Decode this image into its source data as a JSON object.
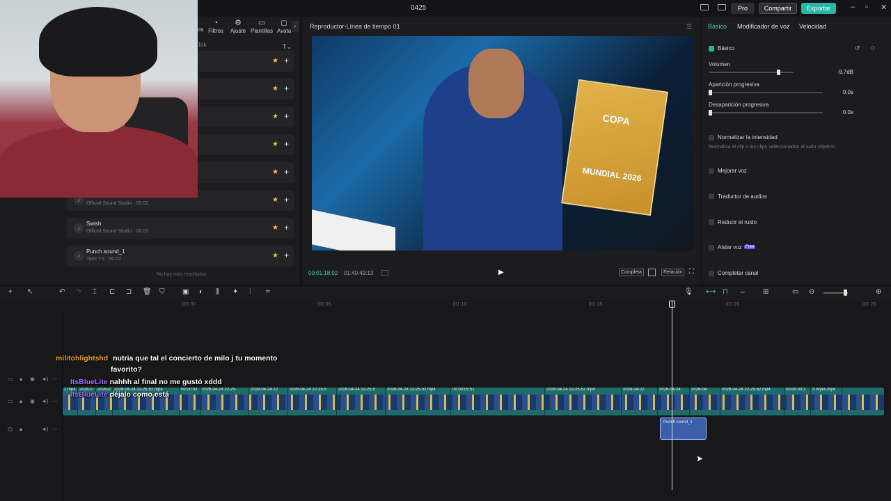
{
  "window": {
    "title": "0425",
    "pro_label": "Pro",
    "share_label": "Compartir",
    "export_label": "Exportar"
  },
  "media_tabs": [
    {
      "label": "Filtros",
      "icon": "filter-icon"
    },
    {
      "label": "Ajuste",
      "icon": "adjust-icon"
    },
    {
      "label": "Plantillas",
      "icon": "template-icon"
    },
    {
      "label": "Avata",
      "icon": "avatar-icon"
    }
  ],
  "tabs_partial": "os",
  "filter_chip": "Tok",
  "sound_list": [
    {
      "name": "",
      "sub": ""
    },
    {
      "name": "",
      "sub": ""
    },
    {
      "name": "",
      "sub": ""
    },
    {
      "name": "",
      "sub": ""
    },
    {
      "name": "",
      "sub": ""
    },
    {
      "name": "",
      "sub": "Official Sound Studio · 00:02"
    },
    {
      "name": "Swish",
      "sub": "Official Sound Studio · 00:01"
    },
    {
      "name": "Punch sound_1",
      "sub": "Tami Y's · 00:02"
    }
  ],
  "no_more": "No hay más resultados",
  "player": {
    "title": "Reproductor-Línea de tiempo 01",
    "current_time": "00:01:18:02",
    "total_time": "01:40:49:13",
    "full_label": "Completa",
    "ratio_label": "Relación",
    "album_top": "COPA",
    "album_bottom": "MUNDIAL 2026"
  },
  "right_panel": {
    "tabs": [
      "Básico",
      "Modificador de voz",
      "Velocidad"
    ],
    "section": "Básico",
    "volume_label": "Volumen",
    "volume_value": "-9.7dB",
    "volume_level": 0.82,
    "fade_in_label": "Aparición progresiva",
    "fade_in_value": "0.0s",
    "fade_out_label": "Desaparición progresiva",
    "fade_out_value": "0.0s",
    "normalize_label": "Normalizar la intensidad",
    "normalize_desc": "Normaliza el clip o los clips seleccionados al valor objetivo.",
    "options": [
      "Mejorar voz",
      "Traductor de audios",
      "Reducir el ruido",
      "Aislar voz",
      "Completar canal"
    ],
    "free_badge": "Free"
  },
  "ruler_ticks": [
    "|01:00",
    "|01:05",
    "|01:10",
    "|01:15",
    "|01:20",
    "|01:25"
  ],
  "clips": [
    {
      "label": "2.mp4",
      "w": 22
    },
    {
      "label": "2026-0",
      "w": 26
    },
    {
      "label": "2026-0",
      "w": 24
    },
    {
      "label": "2026-04-24 22-25-52.mp4",
      "w": 96
    },
    {
      "label": "00:00:03",
      "w": 30
    },
    {
      "label": "2026-04-24 22-25-",
      "w": 70
    },
    {
      "label": "2026-04-24 22",
      "w": 56
    },
    {
      "label": "2026-04-24 22-25-5",
      "w": 70
    },
    {
      "label": "2026-04-24 22-25-5",
      "w": 70
    },
    {
      "label": "2026-04-24 22-25-52.mp4",
      "w": 94
    },
    {
      "label": "00:00:05:51",
      "w": 135
    },
    {
      "label": "2026-04-24 22-25-52.mp4",
      "w": 110
    },
    {
      "label": "2026-04-22",
      "w": 52
    },
    {
      "label": "2026-04-24",
      "w": 46
    },
    {
      "label": "2026-04-",
      "w": 44
    },
    {
      "label": "2026-04-24 22-25-52.mp4",
      "w": 92
    },
    {
      "label": "00:00:03:2",
      "w": 38
    },
    {
      "label": "3 reyes.mp4",
      "w": 45
    }
  ],
  "audio_clip": "Punch sound_1",
  "chat": [
    {
      "user": "militohlightshd",
      "msg": "nutria que tal el concierto de milo j tu momento"
    },
    {
      "user": "",
      "msg": "favorito?"
    },
    {
      "user": "ItsBlueLite",
      "msg": "nahhh al final no me gustó xddd"
    },
    {
      "user": "ItsBlueLite",
      "msg": "déjalo como está"
    }
  ]
}
